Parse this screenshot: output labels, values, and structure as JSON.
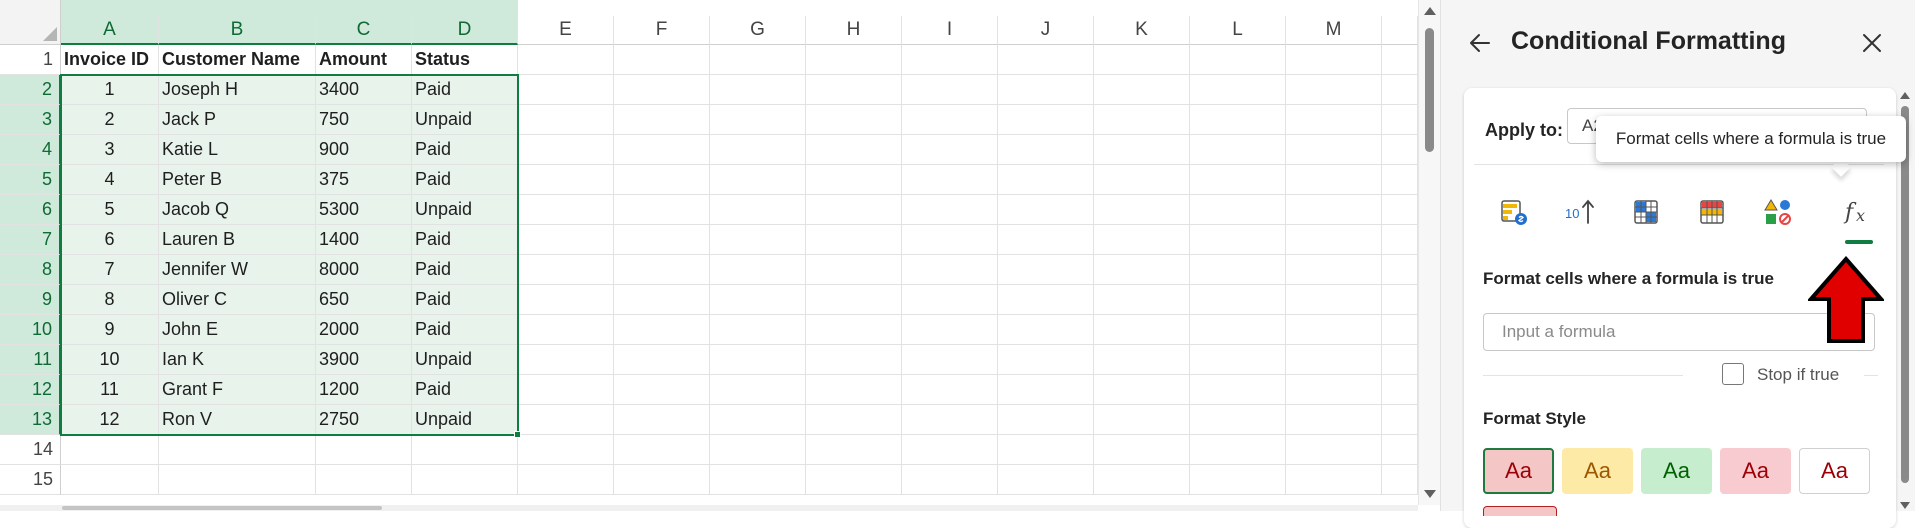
{
  "sheet": {
    "columns": [
      "A",
      "B",
      "C",
      "D",
      "E",
      "F",
      "G",
      "H",
      "I",
      "J",
      "K",
      "L",
      "M"
    ],
    "row_numbers": [
      "1",
      "2",
      "3",
      "4",
      "5",
      "6",
      "7",
      "8",
      "9",
      "10",
      "11",
      "12",
      "13",
      "14",
      "15"
    ],
    "headers": [
      "Invoice ID",
      "Customer Name",
      "Amount",
      "Status"
    ],
    "rows": [
      [
        "1",
        "Joseph H",
        "3400",
        "Paid"
      ],
      [
        "2",
        "Jack P",
        "750",
        "Unpaid"
      ],
      [
        "3",
        "Katie L",
        "900",
        "Paid"
      ],
      [
        "4",
        "Peter B",
        "375",
        "Paid"
      ],
      [
        "5",
        "Jacob Q",
        "5300",
        "Unpaid"
      ],
      [
        "6",
        "Lauren B",
        "1400",
        "Paid"
      ],
      [
        "7",
        "Jennifer W",
        "8000",
        "Paid"
      ],
      [
        "8",
        "Oliver C",
        "650",
        "Paid"
      ],
      [
        "9",
        "John E",
        "2000",
        "Paid"
      ],
      [
        "10",
        "Ian K",
        "3900",
        "Unpaid"
      ],
      [
        "11",
        "Grant F",
        "1200",
        "Paid"
      ],
      [
        "12",
        "Ron V",
        "2750",
        "Unpaid"
      ]
    ]
  },
  "panel": {
    "title": "Conditional Formatting",
    "apply_to_label": "Apply to:",
    "apply_to_value": "A2",
    "tooltip": "Format cells where a formula is true",
    "rule_icons": [
      "data-bar-icon",
      "top-bottom-rules-icon",
      "color-scale-icon",
      "highlight-cells-icon",
      "icon-sets-icon",
      "formula-fx-icon"
    ],
    "formula_heading": "Format cells where a formula is true",
    "formula_placeholder": "Input a formula",
    "stop_if_true": "Stop if true",
    "format_style_heading": "Format Style",
    "swatches": [
      {
        "label": "Aa",
        "bg": "#f4c6c6",
        "fg": "#9c0006",
        "border": "#1f7a3f"
      },
      {
        "label": "Aa",
        "bg": "#fdeaa6",
        "fg": "#9c5700",
        "border": "#fdeaa6"
      },
      {
        "label": "Aa",
        "bg": "#c6eece",
        "fg": "#006100",
        "border": "#c6eece"
      },
      {
        "label": "Aa",
        "bg": "#f7cbd0",
        "fg": "#9c0006",
        "border": "#f7cbd0"
      },
      {
        "label": "Aa",
        "bg": "#ffffff",
        "fg": "#9c0006",
        "border": "#d0d0d0"
      }
    ]
  },
  "colors": {
    "accent": "#107c41",
    "selection_fill": "#e8f3ec",
    "header_selected": "#cfeadb",
    "annotation_arrow": "#e00000"
  }
}
